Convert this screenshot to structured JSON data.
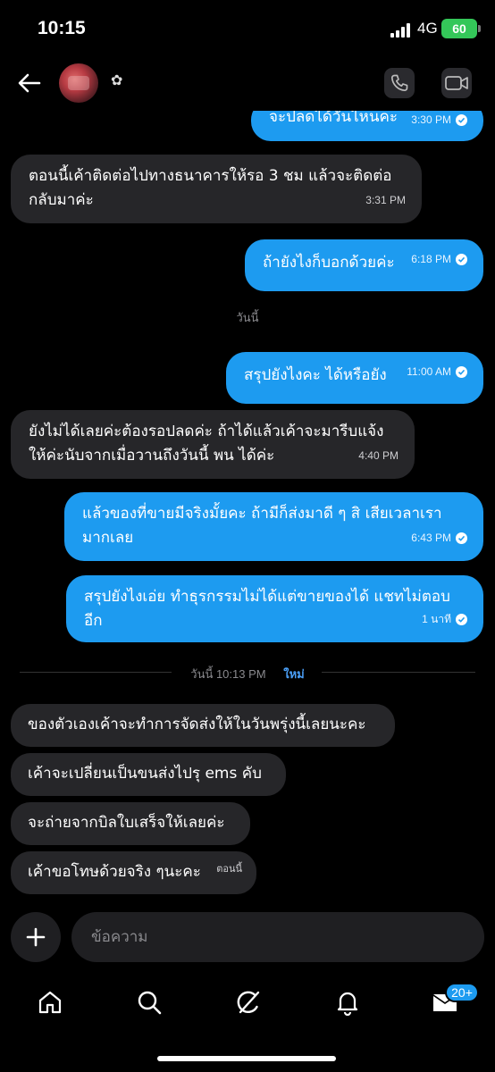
{
  "status_bar": {
    "time": "10:15",
    "network": "4G",
    "battery": "60"
  },
  "header": {
    "contact_name": "✿"
  },
  "messages": [
    {
      "dir": "out",
      "text": "จะปลดได้วันไหนคะ",
      "time": "3:30 PM"
    },
    {
      "dir": "in",
      "text": "ตอนนี้เค้าติดต่อไปทางธนาคารให้รอ 3 ชม แล้วจะติดต่อกลับมาค่ะ",
      "time": "3:31 PM"
    },
    {
      "dir": "out",
      "text": "ถ้ายังไงก็บอกด้วยค่ะ",
      "time": "6:18 PM"
    },
    {
      "dir": "out",
      "text": "สรุปยังไงคะ ได้หรือยัง",
      "time": "11:00 AM"
    },
    {
      "dir": "in",
      "text": "ยังไม่ได้เลยค่ะต้องรอปลดค่ะ ถ้าได้แล้วเค้าจะมารีบแจ้งให้ค่ะนับจากเมื่อวานถึงวันนี้ พน ได้ค่ะ",
      "time": "4:40 PM"
    },
    {
      "dir": "out",
      "text": "แล้วของที่ขายมีจริงมั้ยคะ ถ้ามีก็ส่งมาดี ๆ สิ เสียเวลาเรามากเลย",
      "time": "6:43 PM"
    },
    {
      "dir": "out",
      "text": "สรุปยังไงเอ่ย ทำธุรกรรมไม่ได้แต่ขายของได้ แชทไม่ตอบอีก",
      "time": "1 นาที"
    },
    {
      "dir": "in",
      "text": "ของตัวเองเค้าจะทำการจัดส่งให้ในวันพรุ่งนี้เลยนะคะ"
    },
    {
      "dir": "in",
      "text": "เค้าจะเปลี่ยนเป็นขนส่งไปรุ ems คับ"
    },
    {
      "dir": "in",
      "text": "จะถ่ายจากบิลใบเสร็จให้เลยค่ะ"
    },
    {
      "dir": "in",
      "text": "เค้าขอโทษด้วยจริง ๆนะคะ",
      "time": "ตอนนี้"
    }
  ],
  "day_divider": "วันนี้",
  "new_divider": {
    "text": "วันนี้ 10:13 PM",
    "tag": "ใหม่"
  },
  "composer": {
    "placeholder": "ข้อความ"
  },
  "tabs": {
    "items": [
      {
        "name": "home",
        "icon": "home-icon"
      },
      {
        "name": "search",
        "icon": "search-icon"
      },
      {
        "name": "grok",
        "icon": "slash-circle-icon"
      },
      {
        "name": "notifications",
        "icon": "bell-icon"
      },
      {
        "name": "messages",
        "icon": "envelope-icon"
      }
    ],
    "messages_badge": "20+"
  },
  "colors": {
    "accent": "#1d9bf0",
    "incoming_bubble": "#262629",
    "background": "#000000",
    "battery": "#34c759"
  }
}
